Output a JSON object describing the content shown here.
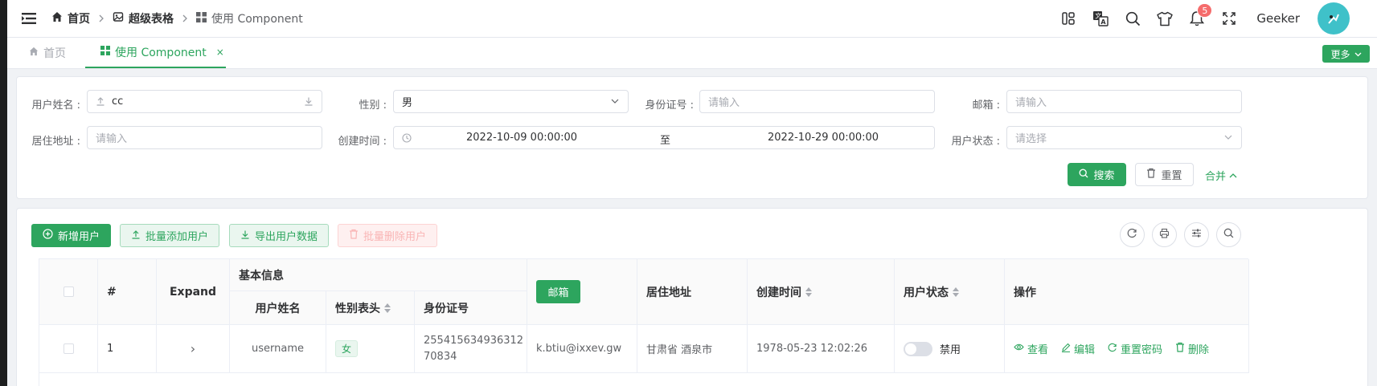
{
  "breadcrumb": [
    {
      "label": "首页",
      "icon": "home-icon"
    },
    {
      "label": "超级表格",
      "icon": "table-icon"
    },
    {
      "label": "使用 Component",
      "icon": "grid-icon"
    }
  ],
  "header": {
    "username": "Geeker",
    "notification_count": "5"
  },
  "tabs": [
    {
      "label": "首页",
      "active": false
    },
    {
      "label": "使用 Component",
      "active": true,
      "close": "×"
    }
  ],
  "more_label": "更多",
  "search": {
    "username": {
      "label": "用户姓名 :",
      "value": "cc"
    },
    "gender": {
      "label": "性别 :",
      "value": "男"
    },
    "idcard": {
      "label": "身份证号 :",
      "placeholder": "请输入"
    },
    "email": {
      "label": "邮箱 :",
      "placeholder": "请输入"
    },
    "address": {
      "label": "居住地址 :",
      "placeholder": "请输入"
    },
    "created": {
      "label": "创建时间 :",
      "start": "2022-10-09 00:00:00",
      "separator": "至",
      "end": "2022-10-29 00:00:00"
    },
    "status": {
      "label": "用户状态 :",
      "placeholder": "请选择"
    },
    "search_btn": "搜索",
    "reset_btn": "重置",
    "collapse_btn": "合并"
  },
  "toolbar": {
    "add": "新增用户",
    "batch_add": "批量添加用户",
    "export": "导出用户数据",
    "batch_delete": "批量删除用户"
  },
  "table": {
    "headers": {
      "index": "#",
      "expand": "Expand",
      "basic": "基本信息",
      "username": "用户姓名",
      "gender": "性别表头",
      "idcard": "身份证号",
      "email": "邮箱",
      "address": "居住地址",
      "created": "创建时间",
      "status": "用户状态",
      "ops": "操作"
    },
    "rows": [
      {
        "index": "1",
        "expand": "›",
        "username": "username",
        "gender": "女",
        "idcard_line1": "255415634936312",
        "idcard_line2": "70834",
        "email": "k.btiu@ixxev.gw",
        "address": "甘肃省 酒泉市",
        "created": "1978-05-23 12:02:26",
        "status": "禁用"
      }
    ],
    "ops": {
      "view": "查看",
      "edit": "编辑",
      "reset_pwd": "重置密码",
      "delete": "删除"
    }
  },
  "colors": {
    "primary": "#2da55e",
    "danger": "#f56c6c"
  }
}
